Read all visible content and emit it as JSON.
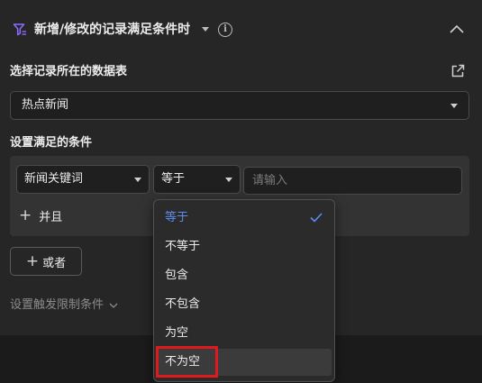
{
  "header": {
    "title": "新增/修改的记录满足条件时"
  },
  "table_section": {
    "label": "选择记录所在的数据表",
    "selected_table": "热点新闻"
  },
  "condition_section": {
    "label": "设置满足的条件",
    "field_value": "新闻关键词",
    "operator_value": "等于",
    "input_placeholder": "请输入",
    "and_label": "并且"
  },
  "or_button": {
    "label": "或者"
  },
  "trigger_limit": {
    "label": "设置触发限制条件"
  },
  "dropdown": {
    "options": [
      "等于",
      "不等于",
      "包含",
      "不包含",
      "为空",
      "不为空"
    ],
    "selected": "等于",
    "highlighted": "不为空"
  },
  "colors": {
    "accent": "#5b8def",
    "highlight": "#e0191e",
    "filter_icon": "#8b6cff"
  }
}
